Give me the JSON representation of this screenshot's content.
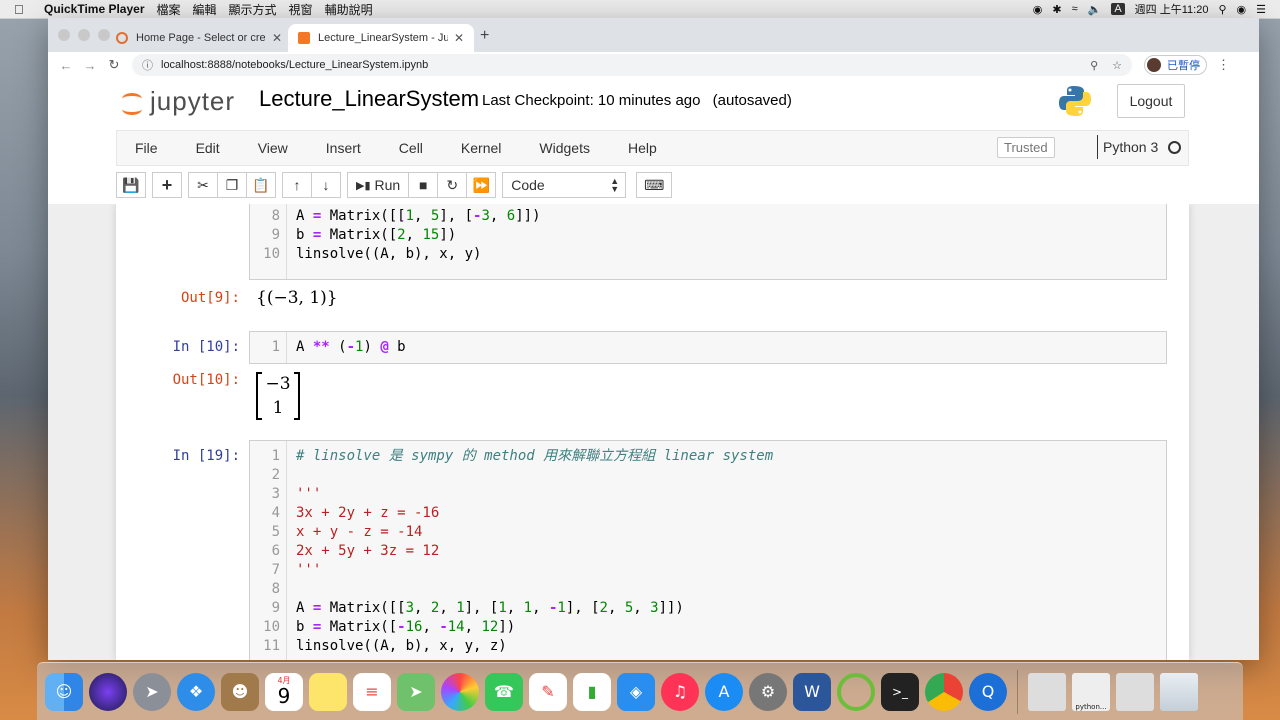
{
  "menubar": {
    "app_name": "QuickTime Player",
    "items": [
      "檔案",
      "編輯",
      "顯示方式",
      "視窗",
      "輔助說明"
    ],
    "input_indicator": "A",
    "clock": "週四 上午11:20"
  },
  "browser": {
    "tabs": [
      {
        "title": "Home Page - Select or create a",
        "active": false
      },
      {
        "title": "Lecture_LinearSystem - Jupyter",
        "active": true
      }
    ],
    "url": "localhost:8888/notebooks/Lecture_LinearSystem.ipynb",
    "profile_label": "已暫停"
  },
  "jupyter": {
    "logo_text": "jupyter",
    "notebook_name": "Lecture_LinearSystem",
    "checkpoint_text": "Last Checkpoint: 10 minutes ago",
    "autosave_text": "(autosaved)",
    "logout_label": "Logout",
    "menu": [
      "File",
      "Edit",
      "View",
      "Insert",
      "Cell",
      "Kernel",
      "Widgets",
      "Help"
    ],
    "trusted_label": "Trusted",
    "kernel_name": "Python 3",
    "toolbar": {
      "run_label": "Run",
      "cell_type": "Code"
    }
  },
  "cells": {
    "cell9": {
      "lines": [
        {
          "n": "8",
          "code": "A = Matrix([[1, 5], [-3, 6]])"
        },
        {
          "n": "9",
          "code": "b = Matrix([2, 15])"
        },
        {
          "n": "10",
          "code": "linsolve((A, b), x, y)"
        }
      ],
      "out_prompt": "Out[9]:",
      "output": "{(−3, 1)}"
    },
    "cell10": {
      "in_prompt": "In [10]:",
      "lines": [
        {
          "n": "1",
          "code": "A ** (-1) @ b"
        }
      ],
      "out_prompt": "Out[10]:",
      "matrix": [
        "−3",
        "1"
      ]
    },
    "cell19": {
      "in_prompt": "In [19]:",
      "lines": [
        {
          "n": "1",
          "code": "# linsolve 是 sympy 的 method 用來解聯立方程組 linear system"
        },
        {
          "n": "2",
          "code": ""
        },
        {
          "n": "3",
          "code": "'''"
        },
        {
          "n": "4",
          "code": "3x + 2y + z = -16"
        },
        {
          "n": "5",
          "code": "x + y - z = -14"
        },
        {
          "n": "6",
          "code": "2x + 5y + 3z = 12"
        },
        {
          "n": "7",
          "code": "'''"
        },
        {
          "n": "8",
          "code": ""
        },
        {
          "n": "9",
          "code": "A = Matrix([[3, 2, 1], [1, 1, -1], [2, 5, 3]])"
        },
        {
          "n": "10",
          "code": "b = Matrix([-16, -14, 12])"
        },
        {
          "n": "11",
          "code": "linsolve((A, b), x, y, z)"
        }
      ]
    }
  },
  "dock": {
    "calendar_month": "4月",
    "calendar_day": "9",
    "python_label": "python..."
  }
}
